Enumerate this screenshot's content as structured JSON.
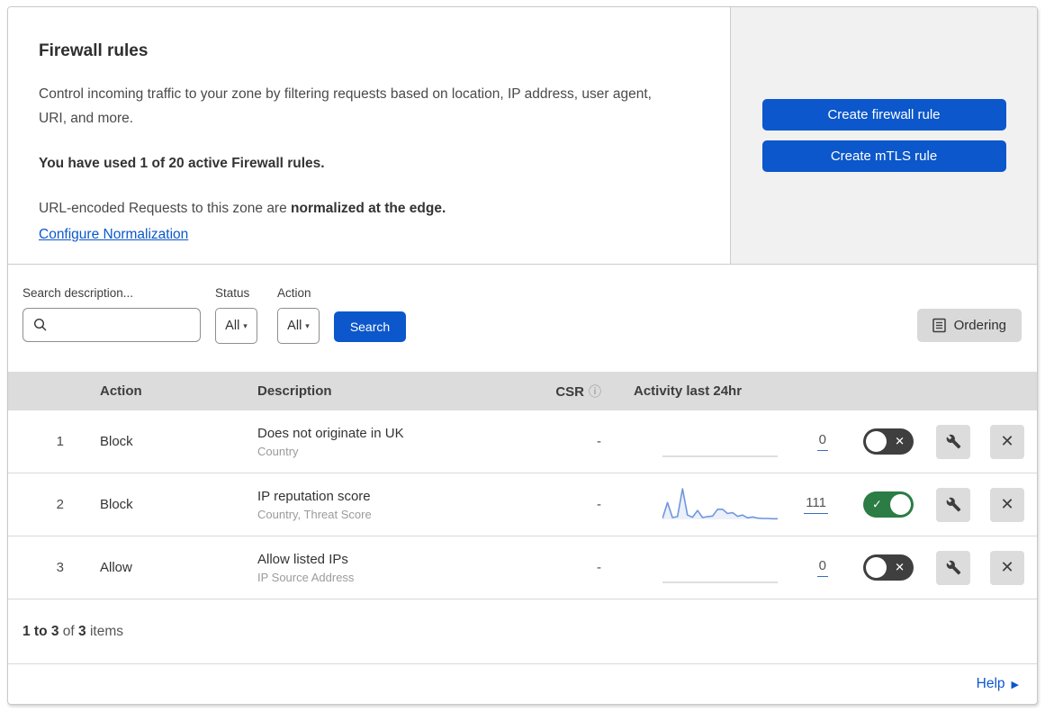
{
  "header": {
    "title": "Firewall rules",
    "description": "Control incoming traffic to your zone by filtering requests based on location, IP address, user agent, URI, and more.",
    "usage": "You have used 1 of 20 active Firewall rules.",
    "normalization_text": "URL-encoded Requests to this zone are ",
    "normalization_bold": "normalized at the edge.",
    "normalization_link": "Configure Normalization",
    "create_firewall_button": "Create firewall rule",
    "create_mtls_button": "Create mTLS rule"
  },
  "filters": {
    "search_label": "Search description...",
    "search_value": "",
    "status_label": "Status",
    "status_value": "All",
    "action_label": "Action",
    "action_value": "All",
    "search_button": "Search",
    "ordering_button": "Ordering"
  },
  "table": {
    "columns": {
      "action": "Action",
      "description": "Description",
      "csr": "CSR",
      "csr_info_icon": "info-icon",
      "activity": "Activity last 24hr"
    },
    "rules": [
      {
        "num": "1",
        "action": "Block",
        "description": "Does not originate in UK",
        "fields": "Country",
        "csr": "-",
        "activity_count": "0",
        "enabled": false,
        "activity_points": []
      },
      {
        "num": "2",
        "action": "Block",
        "description": "IP reputation score",
        "fields": "Country, Threat Score",
        "csr": "-",
        "activity_count": "111",
        "enabled": true,
        "activity_points": [
          3,
          55,
          6,
          9,
          100,
          14,
          7,
          29,
          6,
          9,
          11,
          33,
          33,
          19,
          22,
          10,
          14,
          5,
          8,
          4,
          3,
          3,
          2,
          2
        ]
      },
      {
        "num": "3",
        "action": "Allow",
        "description": "Allow listed IPs",
        "fields": "IP Source Address",
        "csr": "-",
        "activity_count": "0",
        "enabled": false,
        "activity_points": []
      }
    ]
  },
  "footer": {
    "range": "1 to 3",
    "of_word": " of ",
    "total": "3",
    "items_word": " items",
    "help_label": "Help"
  },
  "colors": {
    "accent_blue": "#0b57cb",
    "toggle_on_green": "#2b7c45",
    "toggle_off_gray": "#3f3f3f",
    "sparkline_blue": "#7096de",
    "sparkline_flat_gray": "#c9c9c9",
    "table_header_gray": "#dcdcdc",
    "panel_gray": "#f1f1f1"
  }
}
